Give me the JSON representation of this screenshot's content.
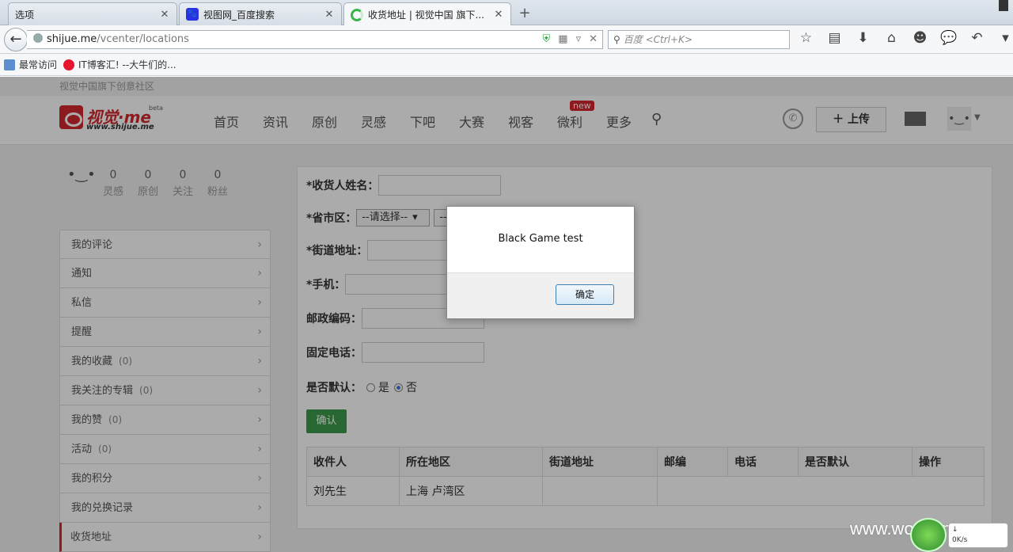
{
  "browser": {
    "tabs": [
      {
        "label": "选项",
        "close": "✕"
      },
      {
        "label": "视图网_百度搜索",
        "close": "✕"
      },
      {
        "label": "收货地址 | 视觉中国 旗下...",
        "close": "✕"
      }
    ],
    "new_tab": "+",
    "url_host": "shijue.me",
    "url_path": "/vcenter/locations",
    "search_placeholder": "百度 <Ctrl+K>",
    "bookmarks": [
      "最常访问",
      "IT博客汇! --大牛们的..."
    ]
  },
  "site": {
    "topstrip": "视觉中国旗下创意社区",
    "logo_text": "视觉·me",
    "logo_sub": "www.shijue.me",
    "logo_beta": "beta",
    "nav": [
      "首页",
      "资讯",
      "原创",
      "灵感",
      "下吧",
      "大赛",
      "视客",
      "微利",
      "更多"
    ],
    "nav_badge": "new",
    "upload_label": "上传"
  },
  "profile": {
    "stats": [
      {
        "num": "0",
        "label": "灵感"
      },
      {
        "num": "0",
        "label": "原创"
      },
      {
        "num": "0",
        "label": "关注"
      },
      {
        "num": "0",
        "label": "粉丝"
      }
    ]
  },
  "sidebar": {
    "items": [
      {
        "label": "我的评论",
        "count": ""
      },
      {
        "label": "通知",
        "count": ""
      },
      {
        "label": "私信",
        "count": ""
      },
      {
        "label": "提醒",
        "count": ""
      },
      {
        "label": "我的收藏",
        "count": "(0)"
      },
      {
        "label": "我关注的专辑",
        "count": "(0)"
      },
      {
        "label": "我的赞",
        "count": "(0)"
      },
      {
        "label": "活动",
        "count": "(0)"
      },
      {
        "label": "我的积分",
        "count": ""
      },
      {
        "label": "我的兑换记录",
        "count": ""
      },
      {
        "label": "收货地址",
        "count": ""
      }
    ]
  },
  "form": {
    "name_label": "*收货人姓名：",
    "region_label": "*省市区：",
    "region_select": "--请选择--",
    "region_select2": "--",
    "street_label": "*街道地址：",
    "phone_label": "*手机：",
    "zip_label": "邮政编码：",
    "tel_label": "固定电话：",
    "default_label": "是否默认：",
    "default_yes": "是",
    "default_no": "否",
    "confirm": "确认"
  },
  "table": {
    "headers": [
      "收件人",
      "所在地区",
      "街道地址",
      "邮编",
      "电话",
      "是否默认",
      "操作"
    ],
    "rows": [
      [
        "刘先生",
        "上海 卢湾区",
        "",
        "",
        "",
        "",
        ""
      ]
    ]
  },
  "dialog": {
    "message": "Black Game test",
    "ok": "确定"
  },
  "watermark": "www.wooyun.org",
  "netmon": {
    "value": "0K/s"
  }
}
